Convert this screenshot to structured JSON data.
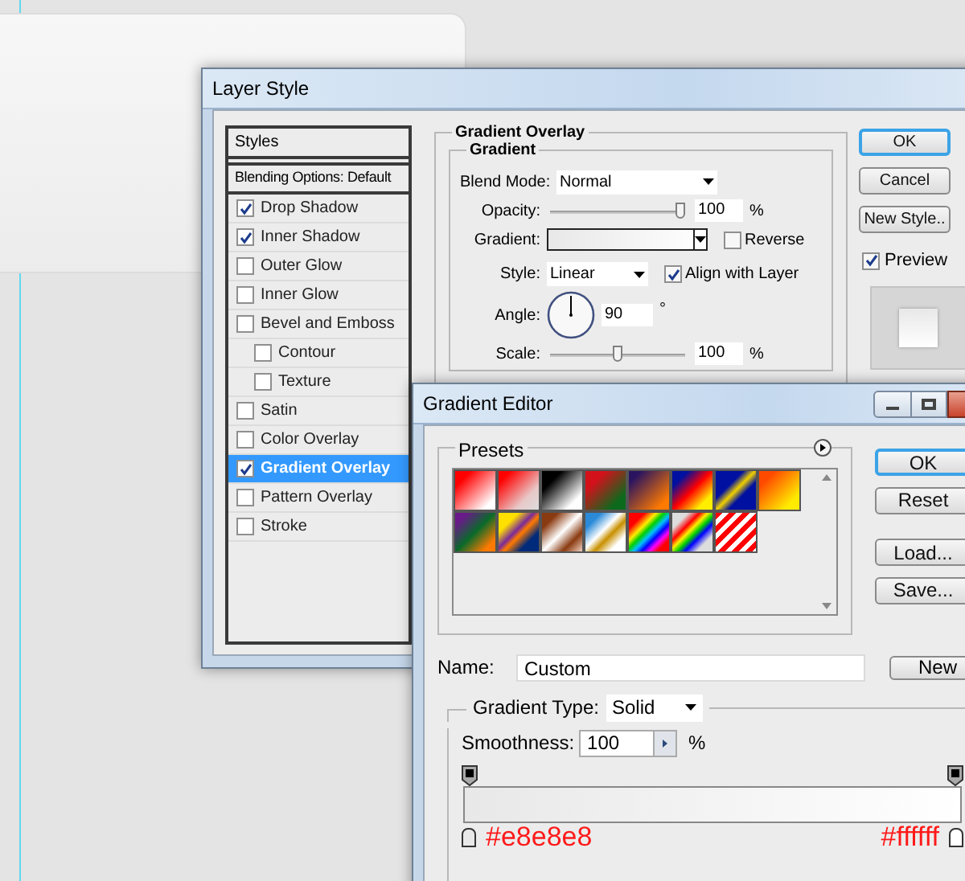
{
  "layer_style": {
    "title": "Layer Style",
    "styles_header": "Styles",
    "blending_options": "Blending Options: Default",
    "effects": [
      {
        "label": "Drop Shadow",
        "checked": true,
        "selected": false
      },
      {
        "label": "Inner Shadow",
        "checked": true,
        "selected": false
      },
      {
        "label": "Outer Glow",
        "checked": false,
        "selected": false
      },
      {
        "label": "Inner Glow",
        "checked": false,
        "selected": false
      },
      {
        "label": "Bevel and Emboss",
        "checked": false,
        "selected": false,
        "children": [
          {
            "label": "Contour",
            "checked": false,
            "selected": false
          },
          {
            "label": "Texture",
            "checked": false,
            "selected": false
          }
        ]
      },
      {
        "label": "Satin",
        "checked": false,
        "selected": false
      },
      {
        "label": "Color Overlay",
        "checked": false,
        "selected": false
      },
      {
        "label": "Gradient Overlay",
        "checked": true,
        "selected": true
      },
      {
        "label": "Pattern Overlay",
        "checked": false,
        "selected": false
      },
      {
        "label": "Stroke",
        "checked": false,
        "selected": false
      }
    ],
    "section_title": "Gradient Overlay",
    "group_title": "Gradient",
    "blend_mode": {
      "label": "Blend Mode:",
      "value": "Normal"
    },
    "opacity": {
      "label": "Opacity:",
      "level": 1,
      "value": "100",
      "unit": "%"
    },
    "gradient": {
      "label": "Gradient:"
    },
    "reverse": {
      "label": "Reverse",
      "checked": false
    },
    "style": {
      "label": "Style:",
      "value": "Linear"
    },
    "align_with_layer": {
      "label": "Align with Layer",
      "checked": true
    },
    "angle": {
      "label": "Angle:",
      "value": "90",
      "unit": "°"
    },
    "scale": {
      "label": "Scale:",
      "level": 0.5,
      "value": "100",
      "unit": "%"
    },
    "buttons": [
      {
        "label": "OK",
        "default": true
      },
      {
        "label": "Cancel",
        "default": false
      },
      {
        "label": "New Style..",
        "default": false
      }
    ],
    "preview": {
      "label": "Preview",
      "checked": true
    }
  },
  "gradient_editor": {
    "title": "Gradient Editor",
    "presets_label": "Presets",
    "buttons": [
      {
        "label": "OK",
        "default": true
      },
      {
        "label": "Reset",
        "default": false
      },
      {
        "label": "Load...",
        "default": false
      },
      {
        "label": "Save...",
        "default": false
      }
    ],
    "name": {
      "label": "Name:",
      "value": "Custom"
    },
    "new_button": "New",
    "gradient_type": {
      "label": "Gradient Type:",
      "value": "Solid"
    },
    "smoothness": {
      "label": "Smoothness:",
      "value": "100",
      "unit": "%"
    },
    "stops": [
      {
        "color": "#e8e8e8",
        "label": "#e8e8e8"
      },
      {
        "color": "#ffffff",
        "label": "#ffffff"
      }
    ]
  }
}
